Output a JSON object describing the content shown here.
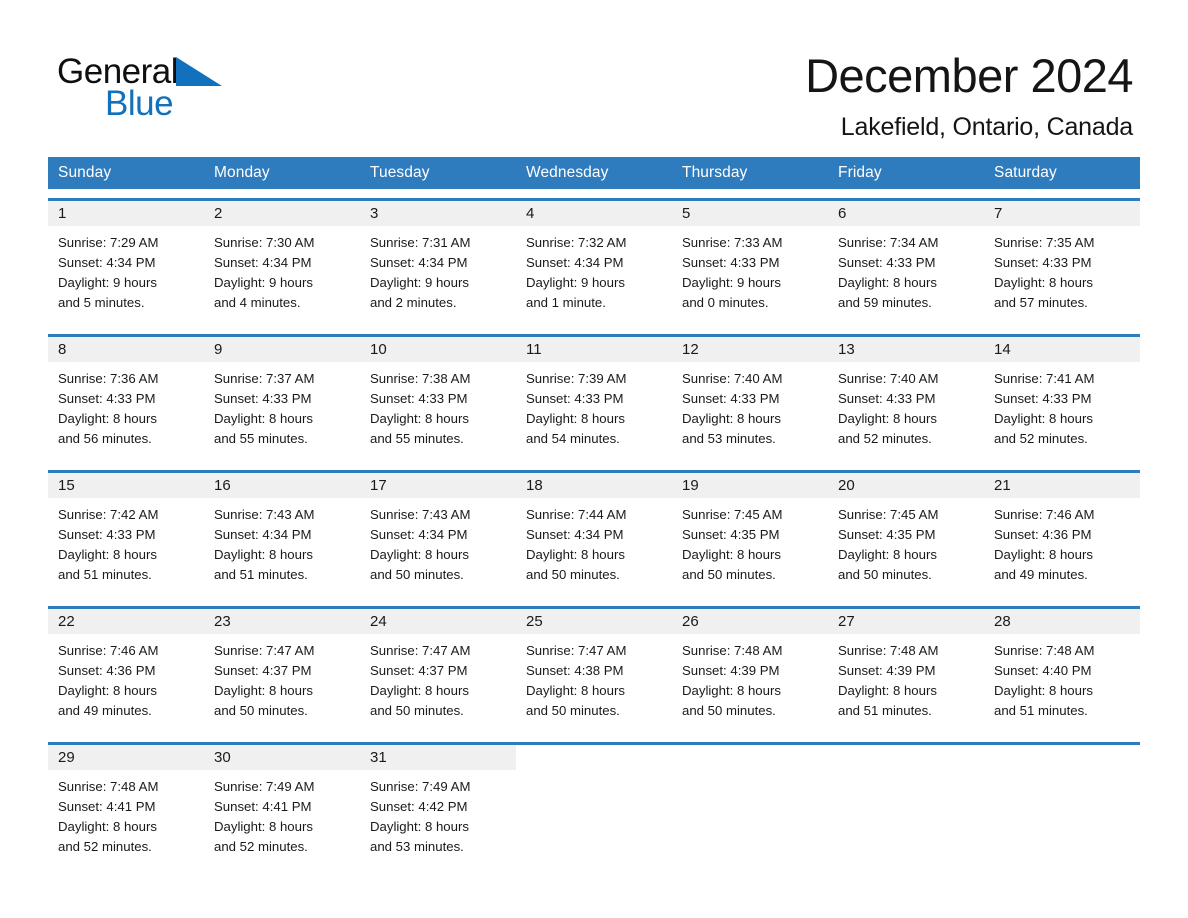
{
  "brand": {
    "name_part1": "General",
    "name_part2": "Blue",
    "triangle_icon": "triangle-icon",
    "color_blue": "#1271bd",
    "color_black": "#0f0f0f"
  },
  "header": {
    "title": "December 2024",
    "subtitle": "Lakefield, Ontario, Canada"
  },
  "calendar": {
    "header_background": "#2e7bbd",
    "daynum_background": "#f0f0f0",
    "weekday_headers": [
      "Sunday",
      "Monday",
      "Tuesday",
      "Wednesday",
      "Thursday",
      "Friday",
      "Saturday"
    ],
    "weeks": [
      {
        "days": [
          {
            "day": "1",
            "sunrise": "Sunrise: 7:29 AM",
            "sunset": "Sunset: 4:34 PM",
            "daylight_line1": "Daylight: 9 hours",
            "daylight_line2": "and 5 minutes."
          },
          {
            "day": "2",
            "sunrise": "Sunrise: 7:30 AM",
            "sunset": "Sunset: 4:34 PM",
            "daylight_line1": "Daylight: 9 hours",
            "daylight_line2": "and 4 minutes."
          },
          {
            "day": "3",
            "sunrise": "Sunrise: 7:31 AM",
            "sunset": "Sunset: 4:34 PM",
            "daylight_line1": "Daylight: 9 hours",
            "daylight_line2": "and 2 minutes."
          },
          {
            "day": "4",
            "sunrise": "Sunrise: 7:32 AM",
            "sunset": "Sunset: 4:34 PM",
            "daylight_line1": "Daylight: 9 hours",
            "daylight_line2": "and 1 minute."
          },
          {
            "day": "5",
            "sunrise": "Sunrise: 7:33 AM",
            "sunset": "Sunset: 4:33 PM",
            "daylight_line1": "Daylight: 9 hours",
            "daylight_line2": "and 0 minutes."
          },
          {
            "day": "6",
            "sunrise": "Sunrise: 7:34 AM",
            "sunset": "Sunset: 4:33 PM",
            "daylight_line1": "Daylight: 8 hours",
            "daylight_line2": "and 59 minutes."
          },
          {
            "day": "7",
            "sunrise": "Sunrise: 7:35 AM",
            "sunset": "Sunset: 4:33 PM",
            "daylight_line1": "Daylight: 8 hours",
            "daylight_line2": "and 57 minutes."
          }
        ]
      },
      {
        "days": [
          {
            "day": "8",
            "sunrise": "Sunrise: 7:36 AM",
            "sunset": "Sunset: 4:33 PM",
            "daylight_line1": "Daylight: 8 hours",
            "daylight_line2": "and 56 minutes."
          },
          {
            "day": "9",
            "sunrise": "Sunrise: 7:37 AM",
            "sunset": "Sunset: 4:33 PM",
            "daylight_line1": "Daylight: 8 hours",
            "daylight_line2": "and 55 minutes."
          },
          {
            "day": "10",
            "sunrise": "Sunrise: 7:38 AM",
            "sunset": "Sunset: 4:33 PM",
            "daylight_line1": "Daylight: 8 hours",
            "daylight_line2": "and 55 minutes."
          },
          {
            "day": "11",
            "sunrise": "Sunrise: 7:39 AM",
            "sunset": "Sunset: 4:33 PM",
            "daylight_line1": "Daylight: 8 hours",
            "daylight_line2": "and 54 minutes."
          },
          {
            "day": "12",
            "sunrise": "Sunrise: 7:40 AM",
            "sunset": "Sunset: 4:33 PM",
            "daylight_line1": "Daylight: 8 hours",
            "daylight_line2": "and 53 minutes."
          },
          {
            "day": "13",
            "sunrise": "Sunrise: 7:40 AM",
            "sunset": "Sunset: 4:33 PM",
            "daylight_line1": "Daylight: 8 hours",
            "daylight_line2": "and 52 minutes."
          },
          {
            "day": "14",
            "sunrise": "Sunrise: 7:41 AM",
            "sunset": "Sunset: 4:33 PM",
            "daylight_line1": "Daylight: 8 hours",
            "daylight_line2": "and 52 minutes."
          }
        ]
      },
      {
        "days": [
          {
            "day": "15",
            "sunrise": "Sunrise: 7:42 AM",
            "sunset": "Sunset: 4:33 PM",
            "daylight_line1": "Daylight: 8 hours",
            "daylight_line2": "and 51 minutes."
          },
          {
            "day": "16",
            "sunrise": "Sunrise: 7:43 AM",
            "sunset": "Sunset: 4:34 PM",
            "daylight_line1": "Daylight: 8 hours",
            "daylight_line2": "and 51 minutes."
          },
          {
            "day": "17",
            "sunrise": "Sunrise: 7:43 AM",
            "sunset": "Sunset: 4:34 PM",
            "daylight_line1": "Daylight: 8 hours",
            "daylight_line2": "and 50 minutes."
          },
          {
            "day": "18",
            "sunrise": "Sunrise: 7:44 AM",
            "sunset": "Sunset: 4:34 PM",
            "daylight_line1": "Daylight: 8 hours",
            "daylight_line2": "and 50 minutes."
          },
          {
            "day": "19",
            "sunrise": "Sunrise: 7:45 AM",
            "sunset": "Sunset: 4:35 PM",
            "daylight_line1": "Daylight: 8 hours",
            "daylight_line2": "and 50 minutes."
          },
          {
            "day": "20",
            "sunrise": "Sunrise: 7:45 AM",
            "sunset": "Sunset: 4:35 PM",
            "daylight_line1": "Daylight: 8 hours",
            "daylight_line2": "and 50 minutes."
          },
          {
            "day": "21",
            "sunrise": "Sunrise: 7:46 AM",
            "sunset": "Sunset: 4:36 PM",
            "daylight_line1": "Daylight: 8 hours",
            "daylight_line2": "and 49 minutes."
          }
        ]
      },
      {
        "days": [
          {
            "day": "22",
            "sunrise": "Sunrise: 7:46 AM",
            "sunset": "Sunset: 4:36 PM",
            "daylight_line1": "Daylight: 8 hours",
            "daylight_line2": "and 49 minutes."
          },
          {
            "day": "23",
            "sunrise": "Sunrise: 7:47 AM",
            "sunset": "Sunset: 4:37 PM",
            "daylight_line1": "Daylight: 8 hours",
            "daylight_line2": "and 50 minutes."
          },
          {
            "day": "24",
            "sunrise": "Sunrise: 7:47 AM",
            "sunset": "Sunset: 4:37 PM",
            "daylight_line1": "Daylight: 8 hours",
            "daylight_line2": "and 50 minutes."
          },
          {
            "day": "25",
            "sunrise": "Sunrise: 7:47 AM",
            "sunset": "Sunset: 4:38 PM",
            "daylight_line1": "Daylight: 8 hours",
            "daylight_line2": "and 50 minutes."
          },
          {
            "day": "26",
            "sunrise": "Sunrise: 7:48 AM",
            "sunset": "Sunset: 4:39 PM",
            "daylight_line1": "Daylight: 8 hours",
            "daylight_line2": "and 50 minutes."
          },
          {
            "day": "27",
            "sunrise": "Sunrise: 7:48 AM",
            "sunset": "Sunset: 4:39 PM",
            "daylight_line1": "Daylight: 8 hours",
            "daylight_line2": "and 51 minutes."
          },
          {
            "day": "28",
            "sunrise": "Sunrise: 7:48 AM",
            "sunset": "Sunset: 4:40 PM",
            "daylight_line1": "Daylight: 8 hours",
            "daylight_line2": "and 51 minutes."
          }
        ]
      },
      {
        "days": [
          {
            "day": "29",
            "sunrise": "Sunrise: 7:48 AM",
            "sunset": "Sunset: 4:41 PM",
            "daylight_line1": "Daylight: 8 hours",
            "daylight_line2": "and 52 minutes."
          },
          {
            "day": "30",
            "sunrise": "Sunrise: 7:49 AM",
            "sunset": "Sunset: 4:41 PM",
            "daylight_line1": "Daylight: 8 hours",
            "daylight_line2": "and 52 minutes."
          },
          {
            "day": "31",
            "sunrise": "Sunrise: 7:49 AM",
            "sunset": "Sunset: 4:42 PM",
            "daylight_line1": "Daylight: 8 hours",
            "daylight_line2": "and 53 minutes."
          },
          {
            "day": "",
            "sunrise": "",
            "sunset": "",
            "daylight_line1": "",
            "daylight_line2": ""
          },
          {
            "day": "",
            "sunrise": "",
            "sunset": "",
            "daylight_line1": "",
            "daylight_line2": ""
          },
          {
            "day": "",
            "sunrise": "",
            "sunset": "",
            "daylight_line1": "",
            "daylight_line2": ""
          },
          {
            "day": "",
            "sunrise": "",
            "sunset": "",
            "daylight_line1": "",
            "daylight_line2": ""
          }
        ]
      }
    ]
  }
}
